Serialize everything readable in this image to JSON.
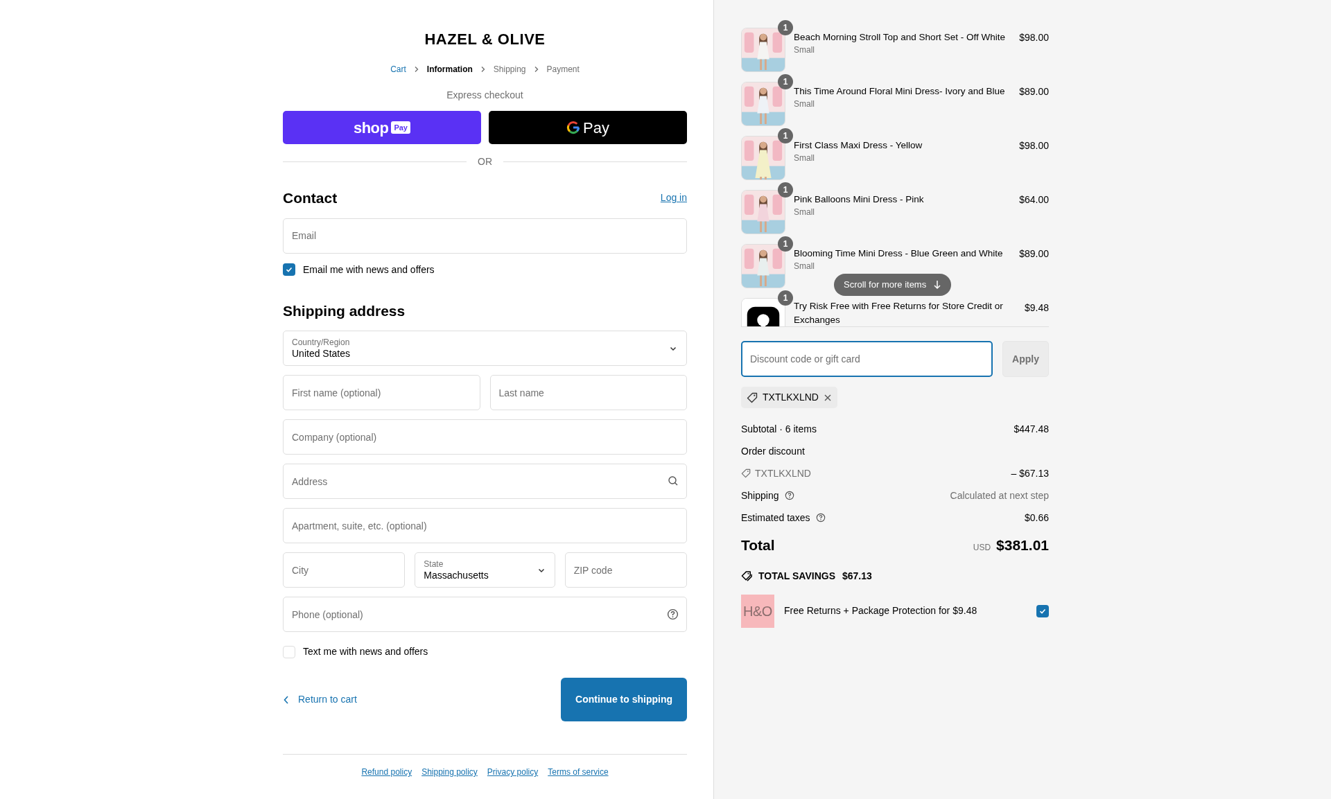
{
  "header": {
    "logo": "HAZEL & OLIVE",
    "breadcrumbs": [
      {
        "label": "Cart",
        "kind": "link"
      },
      {
        "label": "Information",
        "kind": "current"
      },
      {
        "label": "Shipping",
        "kind": "upcoming"
      },
      {
        "label": "Payment",
        "kind": "upcoming"
      }
    ]
  },
  "express_checkout": {
    "title": "Express checkout",
    "buttons": [
      {
        "kind": "shop_pay",
        "label": "shop",
        "badge": "Pay"
      },
      {
        "kind": "google_pay",
        "label": "Pay"
      }
    ],
    "divider": "OR"
  },
  "contact": {
    "heading": "Contact",
    "login_link": "Log in",
    "email": {
      "placeholder": "Email"
    },
    "newsletter": {
      "label": "Email me with news and offers",
      "checked": true
    }
  },
  "shipping_address": {
    "heading": "Shipping address",
    "rows": [
      [
        {
          "kind": "select",
          "label": "Country/Region",
          "value": "United States"
        }
      ],
      [
        {
          "kind": "text",
          "placeholder": "First name (optional)"
        },
        {
          "kind": "text",
          "placeholder": "Last name"
        }
      ],
      [
        {
          "kind": "text",
          "placeholder": "Company (optional)"
        }
      ],
      [
        {
          "kind": "address",
          "placeholder": "Address"
        }
      ],
      [
        {
          "kind": "text",
          "placeholder": "Apartment, suite, etc. (optional)"
        }
      ],
      [
        {
          "kind": "text",
          "placeholder": "City"
        },
        {
          "kind": "select",
          "label": "State",
          "value": "Massachusetts"
        },
        {
          "kind": "text",
          "placeholder": "ZIP code"
        }
      ],
      [
        {
          "kind": "phone",
          "placeholder": "Phone (optional)"
        }
      ]
    ]
  },
  "sms_opt_in": {
    "label": "Text me with news and offers",
    "checked": false
  },
  "actions": {
    "return_link": "Return to cart",
    "continue_button": "Continue to shipping"
  },
  "footer_links": [
    "Refund policy",
    "Shipping policy",
    "Privacy policy",
    "Terms of service"
  ],
  "order_summary": {
    "items": [
      {
        "quantity": "1",
        "title": "Beach Morning Stroll Top and Short Set - Off White",
        "variant": "Small",
        "price": "$98.00"
      },
      {
        "quantity": "1",
        "title": "This Time Around Floral Mini Dress- Ivory and Blue",
        "variant": "Small",
        "price": "$89.00"
      },
      {
        "quantity": "1",
        "title": "First Class Maxi Dress - Yellow",
        "variant": "Small",
        "price": "$98.00"
      },
      {
        "quantity": "1",
        "title": "Pink Balloons Mini Dress - Pink",
        "variant": "Small",
        "price": "$64.00"
      },
      {
        "quantity": "1",
        "title": "Blooming Time Mini Dress - Blue Green and White",
        "variant": "Small",
        "price": "$89.00"
      },
      {
        "kind": "emblem",
        "quantity": "1",
        "title": "Try Risk Free with Free Returns for Store Credit or Exchanges",
        "price": "$9.48"
      }
    ],
    "scroll_hint": "Scroll for more items",
    "discount": {
      "placeholder": "Discount code or gift card",
      "button": "Apply",
      "disabled": true
    },
    "applied_code": "TXTLKXLND",
    "lines": [
      {
        "kind": "plain",
        "label": "Subtotal · 6 items",
        "value": "$447.48",
        "muted": false
      },
      {
        "kind": "plain",
        "label": "Order discount"
      },
      {
        "kind": "code",
        "label": "TXTLKXLND",
        "value": "– $67.13",
        "muted": false
      },
      {
        "kind": "help",
        "label": "Shipping",
        "value": "Calculated at next step",
        "muted": true
      },
      {
        "kind": "help",
        "label": "Estimated taxes",
        "value": "$0.66",
        "muted": false
      }
    ],
    "total": {
      "label": "Total",
      "currency": "USD",
      "amount": "$381.01"
    },
    "savings": {
      "label": "TOTAL SAVINGS",
      "amount": "$67.13"
    },
    "protection": {
      "logo": "H&O",
      "label": "Free Returns + Package Protection for $9.48",
      "checked": true
    }
  }
}
